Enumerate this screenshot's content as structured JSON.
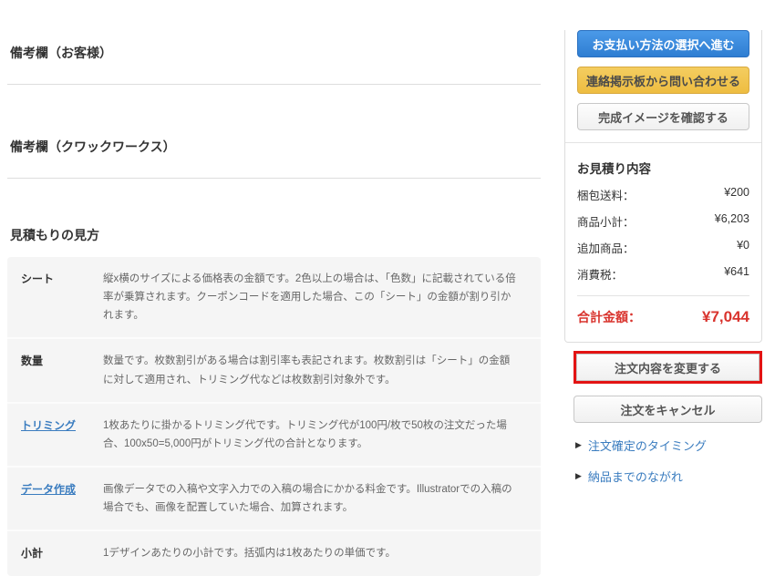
{
  "left": {
    "notes_customer_title": "備考欄（お客様）",
    "notes_company_title": "備考欄（クワックワークス）",
    "glossary_title": "見積もりの見方",
    "glossary": [
      {
        "term": "シート",
        "desc": "縦x横のサイズによる価格表の金額です。2色以上の場合は、「色数」に記載されている倍率が乗算されます。クーポンコードを適用した場合、この「シート」の金額が割り引かれます。"
      },
      {
        "term": "数量",
        "desc": "数量です。枚数割引がある場合は割引率も表記されます。枚数割引は「シート」の金額に対して適用され、トリミング代などは枚数割引対象外です。"
      },
      {
        "term": "トリミング",
        "desc": "1枚あたりに掛かるトリミング代です。トリミング代が100円/枚で50枚の注文だった場合、100x50=5,000円がトリミング代の合計となります。"
      },
      {
        "term": "データ作成",
        "desc": "画像データでの入稿や文字入力での入稿の場合にかかる料金です。Illustratorでの入稿の場合でも、画像を配置していた場合、加算されます。"
      },
      {
        "term": "小計",
        "desc": "1デザインあたりの小計です。括弧内は1枚あたりの単価です。"
      }
    ]
  },
  "sidebar": {
    "buttons": {
      "proceed_payment": "お支払い方法の選択へ進む",
      "contact_board": "連絡掲示板から問い合わせる",
      "check_image": "完成イメージを確認する",
      "change_order": "注文内容を変更する",
      "cancel_order": "注文をキャンセル"
    },
    "estimate": {
      "title": "お見積り内容",
      "rows": [
        {
          "label": "梱包送料：",
          "value": "¥200"
        },
        {
          "label": "商品小計：",
          "value": "¥6,203"
        },
        {
          "label": "追加商品：",
          "value": "¥0"
        },
        {
          "label": "消費税：",
          "value": "¥641"
        }
      ],
      "total_label": "合計金額：",
      "total_value": "¥7,044"
    },
    "links": [
      {
        "arrow": "▶",
        "label": "注文確定のタイミング"
      },
      {
        "arrow": "▶",
        "label": "納品までのながれ"
      }
    ]
  },
  "colors": {
    "primary_button": "#3588da",
    "secondary_button": "#f0c452",
    "total_red": "#d9342e",
    "link_blue": "#3a7cbf",
    "annotation_red": "#e31313"
  }
}
